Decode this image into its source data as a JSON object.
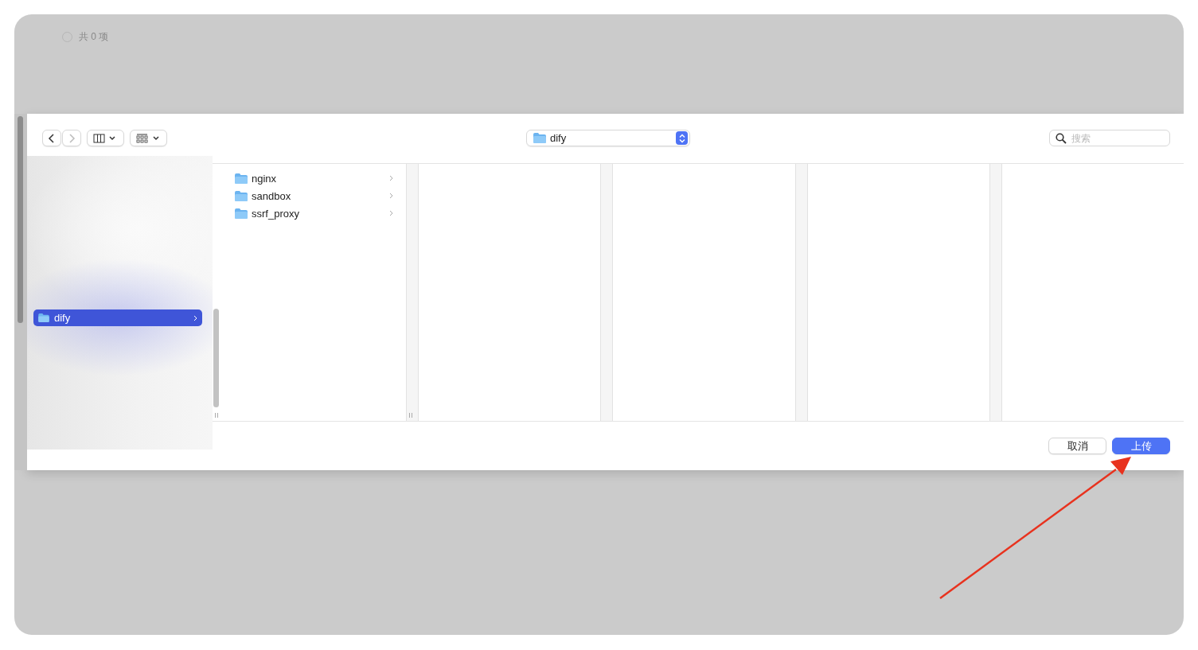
{
  "background": {
    "select_all": {
      "checked": false
    },
    "selection_count": "共 0 项"
  },
  "dialog": {
    "toolbar": {
      "location": "dify",
      "search": {
        "placeholder": "搜索"
      }
    },
    "sidebar": {
      "items": [
        {
          "name": "dify",
          "selected": true
        }
      ]
    },
    "columns": [
      {
        "items": [
          {
            "name": "nginx",
            "selected": false
          },
          {
            "name": "sandbox",
            "selected": false
          },
          {
            "name": "ssrf_proxy",
            "selected": false
          }
        ]
      }
    ],
    "buttons": [
      {
        "label": "取消",
        "kind": "secondary"
      },
      {
        "label": "上传",
        "kind": "primary"
      }
    ]
  },
  "annotation": {
    "kind": "arrow"
  }
}
